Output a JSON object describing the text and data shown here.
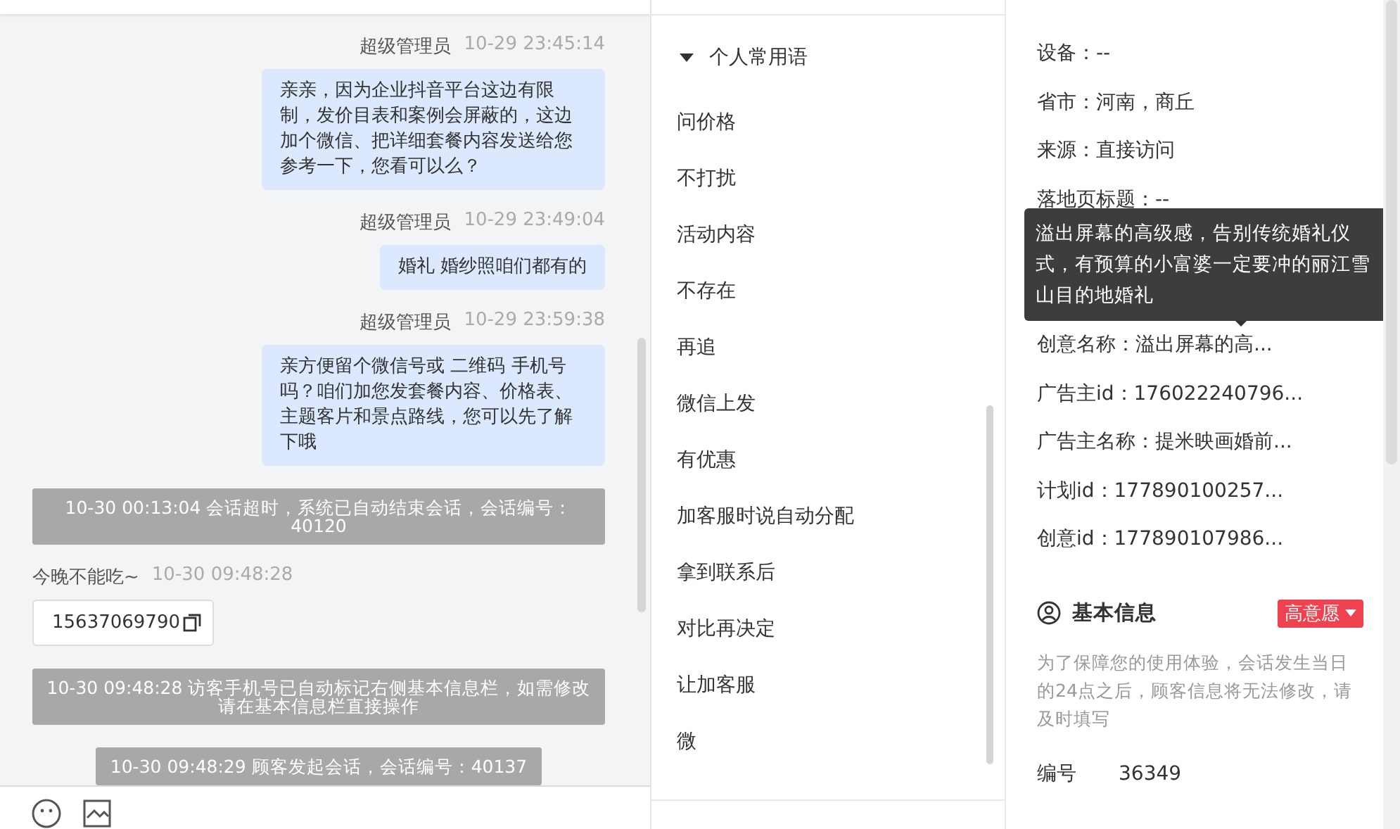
{
  "chat": {
    "messages": [
      {
        "kind": "agent",
        "sender": "超级管理员",
        "time": "10-29 23:45:14",
        "text": "亲亲，因为企业抖音平台这边有限制，发价目表和案例会屏蔽的，这边加个微信、把详细套餐内容发送给您参考一下，您看可以么？"
      },
      {
        "kind": "agent",
        "sender": "超级管理员",
        "time": "10-29 23:49:04",
        "text": "婚礼 婚纱照咱们都有的"
      },
      {
        "kind": "agent",
        "sender": "超级管理员",
        "time": "10-29 23:59:38",
        "text": "亲方便留个微信号或 二维码 手机号吗？咱们加您发套餐内容、价格表、主题客片和景点路线，您可以先了解下哦"
      },
      {
        "kind": "system",
        "text": "10-30 00:13:04 会话超时，系统已自动结束会话，会话编号：40120"
      },
      {
        "kind": "visitor",
        "sender": "今晚不能吃~",
        "time": "10-30 09:48:28",
        "text": "15637069790"
      },
      {
        "kind": "system",
        "text": "10-30 09:48:28 访客手机号已自动标记右侧基本信息栏，如需修改请在基本信息栏直接操作"
      },
      {
        "kind": "system",
        "text": "10-30 09:48:29 顾客发起会话，会话编号：40137"
      }
    ]
  },
  "phrases": {
    "group": "个人常用语",
    "expanded": true,
    "items": [
      "问价格",
      "不打扰",
      "活动内容",
      "不存在",
      "再追",
      "微信上发",
      "有优惠",
      "加客服时说自动分配",
      "拿到联系后",
      "对比再决定",
      "让加客服",
      "微"
    ]
  },
  "source": {
    "rows": [
      "设备：--",
      "省市：河南，商丘",
      "来源：直接访问",
      "落地页标题：--",
      "创意名称：溢出屏幕的高...",
      "广告主id：176022240796...",
      "广告主名称：提米映画婚前...",
      "计划id：177890100257...",
      "创意id：177890107986..."
    ],
    "tooltip": "溢出屏幕的高级感，告别传统婚礼仪式，有预算的小富婆一定要冲的丽江雪山目的地婚礼"
  },
  "basic": {
    "title": "基本信息",
    "tag": "高意愿",
    "note": "为了保障您的使用体验，会话发生当日的24点之后，顾客信息将无法修改，请及时填写",
    "number_label": "编号",
    "number": "36349"
  }
}
